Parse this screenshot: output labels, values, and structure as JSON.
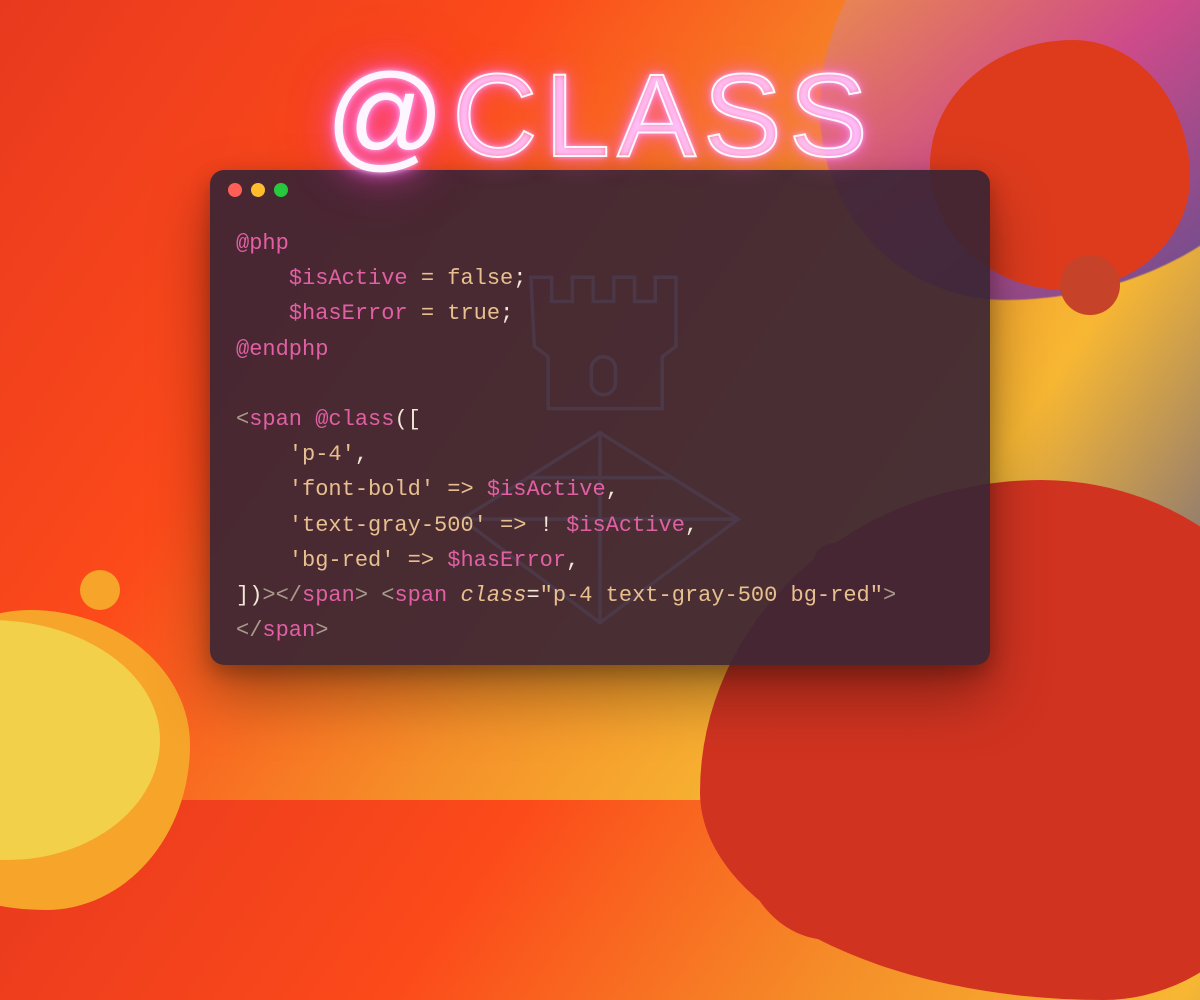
{
  "title": {
    "at": "@",
    "word": "CLASS"
  },
  "window": {
    "buttons": [
      "close",
      "minimize",
      "zoom"
    ]
  },
  "code": {
    "l1_dir": "@php",
    "l2_indent": "    ",
    "l2_var": "$isActive",
    "l2_eq": " = ",
    "l2_val": "false",
    "l2_semi": ";",
    "l3_indent": "    ",
    "l3_var": "$hasError",
    "l3_eq": " = ",
    "l3_val": "true",
    "l3_semi": ";",
    "l4_dir": "@endphp",
    "blank": "",
    "l6_open": "<",
    "l6_tag": "span",
    "l6_sp": " ",
    "l6_dir": "@class",
    "l6_paren": "([",
    "l7_indent": "    ",
    "l7_str": "'p-4'",
    "l7_comma": ",",
    "l8_indent": "    ",
    "l8_str": "'font-bold'",
    "l8_arrow": " => ",
    "l8_var": "$isActive",
    "l8_comma": ",",
    "l9_indent": "    ",
    "l9_str": "'text-gray-500'",
    "l9_arrow": " => ",
    "l9_not": "! ",
    "l9_var": "$isActive",
    "l9_comma": ",",
    "l10_indent": "    ",
    "l10_str": "'bg-red'",
    "l10_arrow": " => ",
    "l10_var": "$hasError",
    "l10_comma": ",",
    "l11_close": "])",
    "l11_gt": ">",
    "l11_ct_open": "</",
    "l11_ct_tag": "span",
    "l11_ct_gt": ">",
    "l11_sp": " ",
    "l11_o2_lt": "<",
    "l11_o2_tag": "span",
    "l11_o2_sp": " ",
    "l11_attr": "class",
    "l11_eq": "=",
    "l11_val": "\"p-4 text-gray-500 bg-red\"",
    "l11_o2_gt": ">",
    "l12_ct_open": "</",
    "l12_ct_tag": "span",
    "l12_ct_gt": ">"
  }
}
